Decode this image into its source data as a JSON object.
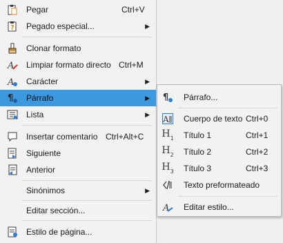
{
  "colors": {
    "highlight": "#3c99e0",
    "menu_bg": "#f2f2f2",
    "icon_dark": "#3a3a3a",
    "icon_blue": "#2f7bd6",
    "icon_orange": "#d88b28"
  },
  "menu": {
    "items": [
      {
        "label": "Pegar",
        "shortcut": "Ctrl+V",
        "icon": "paste-icon"
      },
      {
        "label": "Pegado especial...",
        "icon": "paste-special-icon",
        "submenu": true
      },
      {
        "label": "Clonar formato",
        "icon": "clone-format-brush-icon"
      },
      {
        "label": "Limpiar formato directo",
        "shortcut": "Ctrl+M",
        "icon": "clear-format-icon"
      },
      {
        "label": "Carácter",
        "icon": "character-icon",
        "submenu": true
      },
      {
        "label": "Párrafo",
        "icon": "paragraph-icon",
        "submenu": true,
        "highlighted": true
      },
      {
        "label": "Lista",
        "icon": "list-icon",
        "submenu": true
      },
      {
        "label": "Insertar comentario",
        "shortcut": "Ctrl+Alt+C",
        "icon": "comment-icon"
      },
      {
        "label": "Siguiente",
        "icon": "next-comment-icon"
      },
      {
        "label": "Anterior",
        "icon": "previous-comment-icon"
      },
      {
        "label": "Sinónimos",
        "submenu": true
      },
      {
        "label": "Editar sección..."
      },
      {
        "label": "Estilo de página...",
        "icon": "page-style-icon"
      }
    ]
  },
  "submenu": {
    "items": [
      {
        "label": "Párrafo...",
        "icon": "paragraph-dialog-icon"
      },
      {
        "label": "Cuerpo de texto",
        "shortcut": "Ctrl+0",
        "icon": "body-text-icon"
      },
      {
        "label": "Título 1",
        "shortcut": "Ctrl+1",
        "icon": "heading-1-icon",
        "glyph": "H",
        "num": "1"
      },
      {
        "label": "Título 2",
        "shortcut": "Ctrl+2",
        "icon": "heading-2-icon",
        "glyph": "H",
        "num": "2"
      },
      {
        "label": "Título 3",
        "shortcut": "Ctrl+3",
        "icon": "heading-3-icon",
        "glyph": "H",
        "num": "3"
      },
      {
        "label": "Texto preformateado",
        "icon": "preformatted-text-icon"
      },
      {
        "label": "Editar estilo...",
        "icon": "edit-style-icon"
      }
    ]
  }
}
